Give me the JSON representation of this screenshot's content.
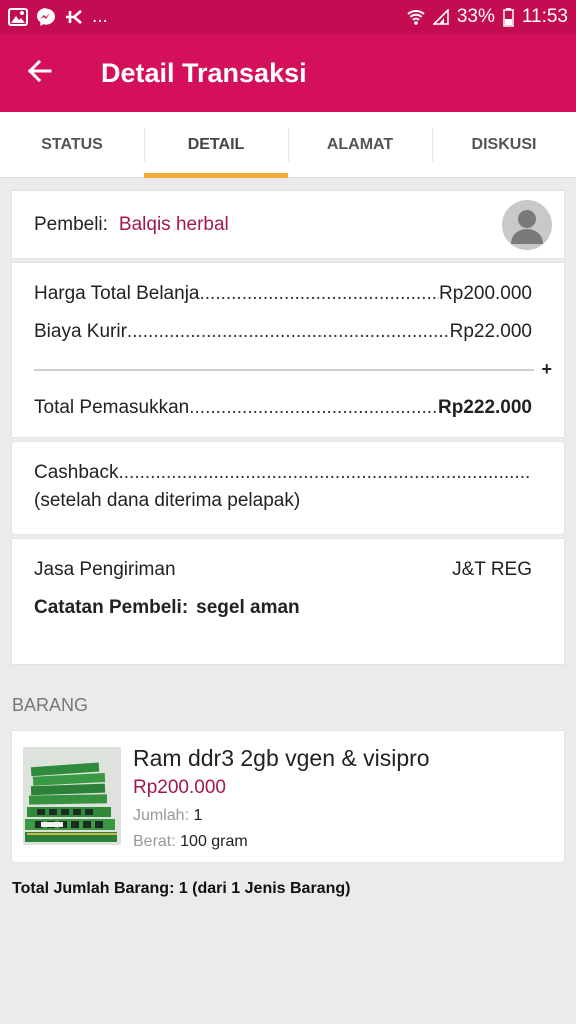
{
  "status_bar": {
    "notif_more": "...",
    "battery": "33%",
    "time": "11:53"
  },
  "header": {
    "title": "Detail Transaksi"
  },
  "tabs": [
    {
      "label": "STATUS"
    },
    {
      "label": "DETAIL",
      "active": true
    },
    {
      "label": "ALAMAT"
    },
    {
      "label": "DISKUSI"
    }
  ],
  "buyer": {
    "label": "Pembeli:",
    "name": "Balqis herbal"
  },
  "summary": {
    "total_belanja_label": "Harga Total Belanja",
    "total_belanja_value": "Rp200.000",
    "kurir_label": "Biaya Kurir",
    "kurir_value": "Rp22.000",
    "plus": "+",
    "pemasukkan_label": "Total Pemasukkan",
    "pemasukkan_value": "Rp222.000"
  },
  "cashback": {
    "label": "Cashback",
    "note": "(setelah dana diterima pelapak)"
  },
  "shipping": {
    "label": "Jasa Pengiriman",
    "value": "J&T REG",
    "note_label": "Catatan Pembeli:",
    "note_value": "segel aman"
  },
  "items_section": {
    "label": "BARANG"
  },
  "product": {
    "name": "Ram ddr3 2gb vgen & visipro",
    "price": "Rp200.000",
    "qty_label": "Jumlah:",
    "qty_value": "1",
    "weight_label": "Berat:",
    "weight_value": "100 gram"
  },
  "footer": {
    "total_items": "Total Jumlah Barang: 1 (dari 1 Jenis Barang)"
  },
  "colors": {
    "primary": "#d4105c",
    "status_bar": "#c40c52",
    "accent_tab": "#f0ad35",
    "price": "#a3174f"
  }
}
